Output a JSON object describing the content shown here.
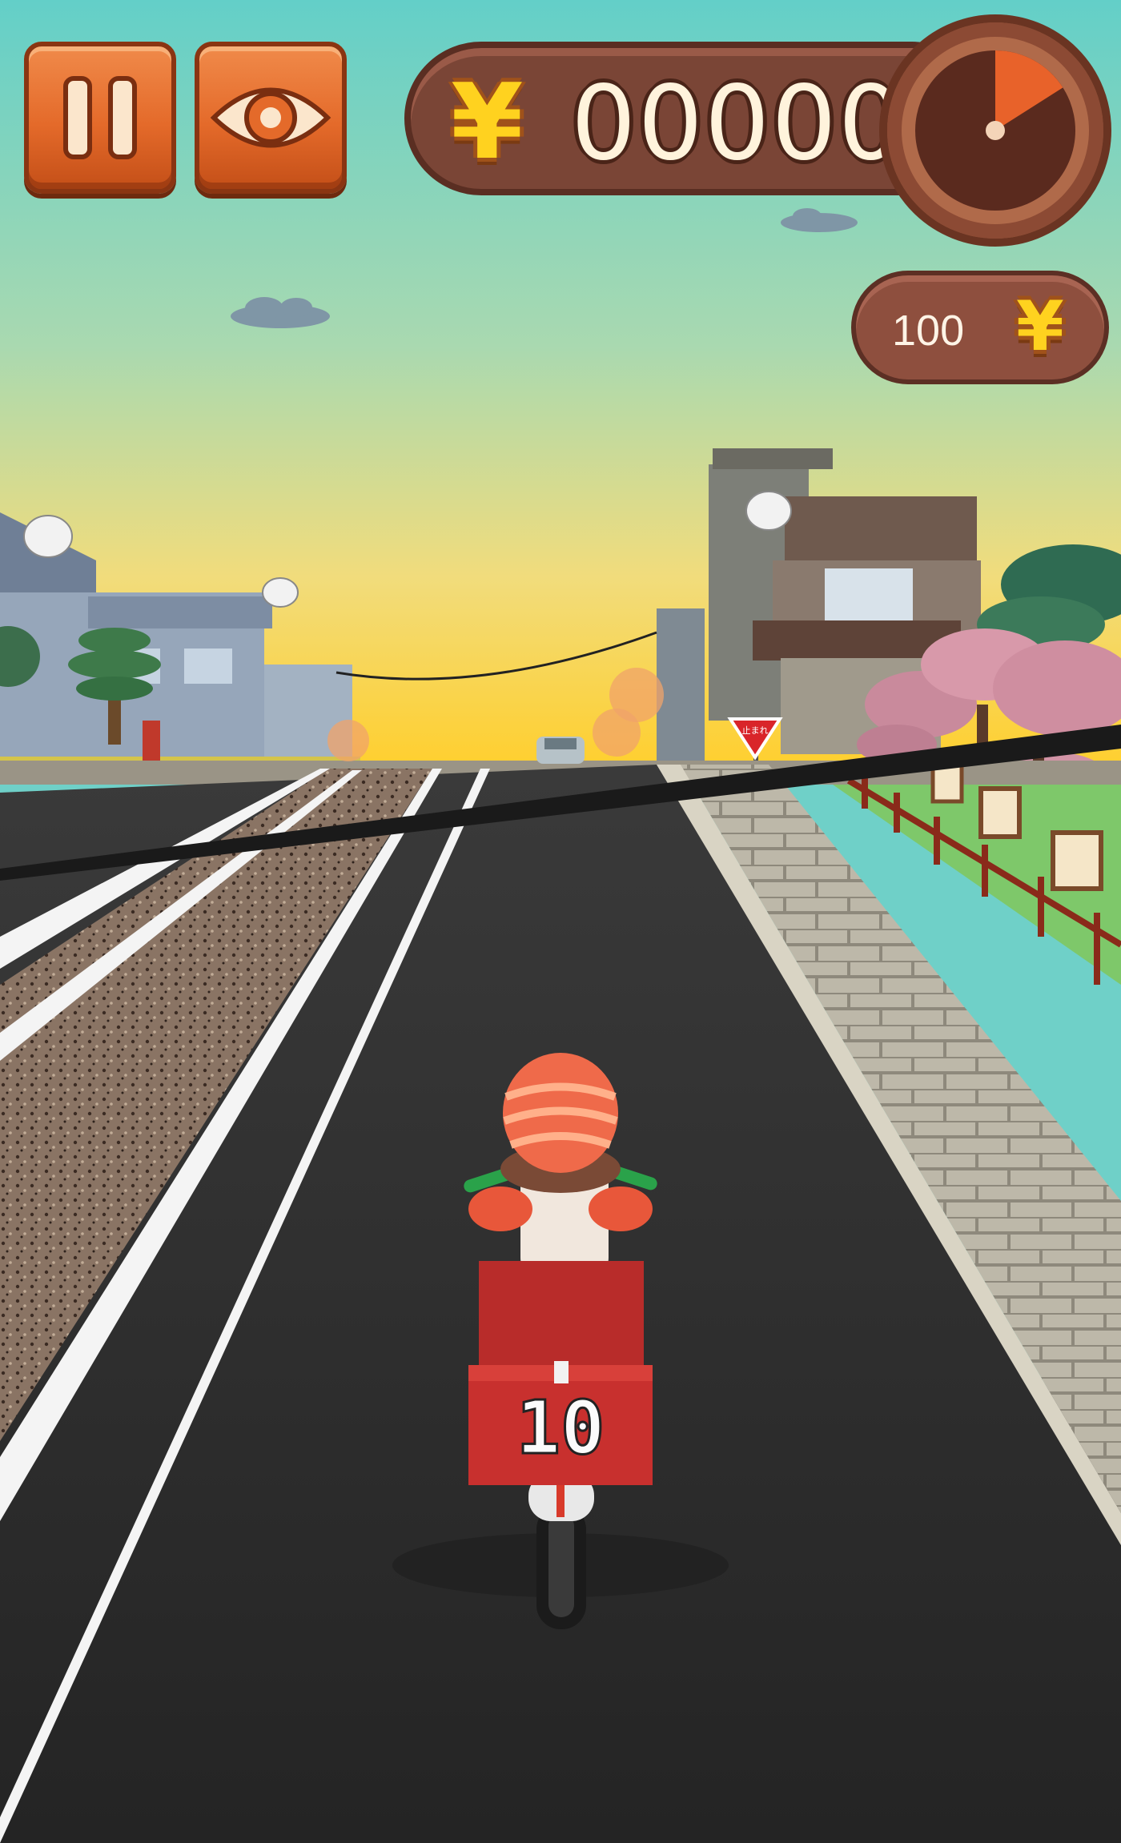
{
  "hud": {
    "pause_icon": "pause-icon",
    "view_icon": "eye-icon",
    "score_value": "00000",
    "currency_symbol": "¥",
    "coins_value": "100",
    "timer_icon": "timer-dial-icon",
    "timer_elapsed_fraction": 0.16
  },
  "world": {
    "bike_number": "10",
    "sign_text": "止まれ"
  },
  "colors": {
    "sky_top": "#62cfc9",
    "sky_horizon": "#ffd23a",
    "road": "#2b2b2b",
    "helmet": "#ef6a4a",
    "delivery_box": "#c8302e",
    "wood_button": "#e46a2a",
    "score_pill": "#7a4536",
    "yen_gold": "#ffd21f"
  }
}
